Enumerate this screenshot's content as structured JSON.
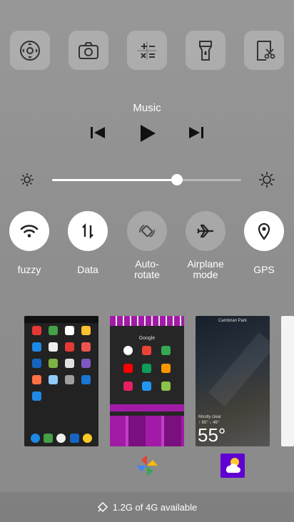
{
  "quick_tiles": [
    {
      "icon": "assistive-touch-icon"
    },
    {
      "icon": "camera-icon"
    },
    {
      "icon": "calculator-icon"
    },
    {
      "icon": "flashlight-icon"
    },
    {
      "icon": "screenshot-icon"
    }
  ],
  "music": {
    "title": "Music",
    "prev_icon": "skip-previous-icon",
    "play_icon": "play-icon",
    "next_icon": "skip-next-icon"
  },
  "brightness": {
    "level": 0.66,
    "low_icon": "brightness-low-icon",
    "high_icon": "brightness-high-icon"
  },
  "toggles": [
    {
      "label": "fuzzy",
      "icon": "wifi-icon",
      "state": "on"
    },
    {
      "label": "Data",
      "icon": "mobile-data-icon",
      "state": "on"
    },
    {
      "label": "Auto-\nrotate",
      "icon": "auto-rotate-icon",
      "state": "off"
    },
    {
      "label": "Airplane\nmode",
      "icon": "airplane-icon",
      "state": "off"
    },
    {
      "label": "GPS",
      "icon": "location-icon",
      "state": "on"
    }
  ],
  "recent_apps": {
    "weather_card": {
      "location": "Cambrian Park",
      "temperature": "55°",
      "condition": "Mostly clear",
      "hi_lo": "↑ 65° ↓ 46°"
    },
    "google_card": {
      "folder_title": "Google"
    },
    "icons": [
      "photos-pinwheel-icon",
      "yahoo-weather-icon"
    ]
  },
  "storage": {
    "text": "1.2G of 4G available",
    "icon": "clean-icon"
  },
  "colors": {
    "tile_bg": "rgba(255,255,255,0.22)",
    "toggle_on": "#ffffff",
    "accent_yahoo": "#5f01d1",
    "google_purple": "#a21ba6"
  }
}
